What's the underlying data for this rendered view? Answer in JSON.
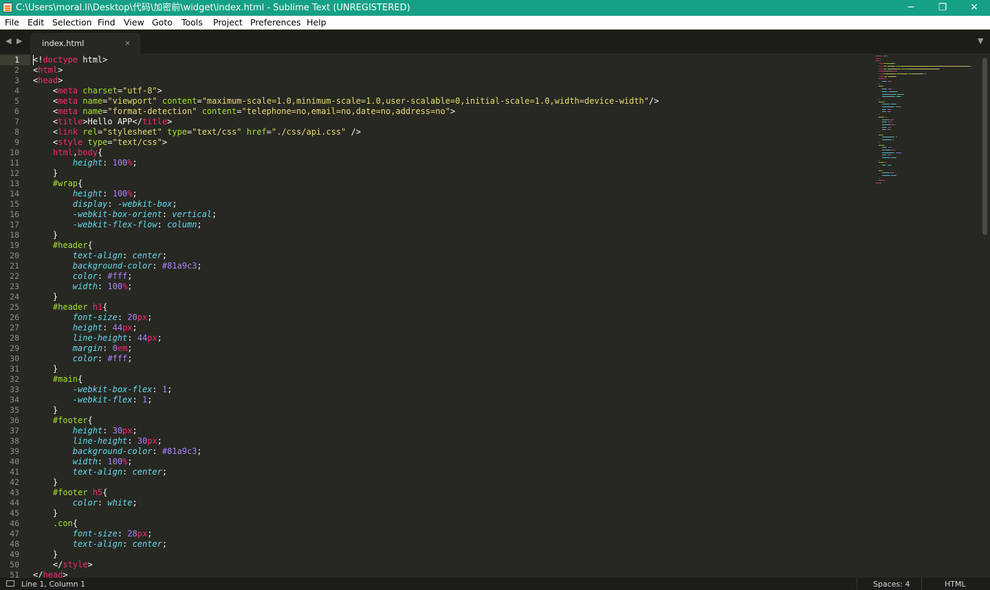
{
  "window": {
    "title": "C:\\Users\\moral.li\\Desktop\\代码\\加密前\\widget\\index.html - Sublime Text (UNREGISTERED)",
    "minimize": "─",
    "restore": "❐",
    "close": "✕",
    "icon": "sublime-text-icon"
  },
  "menu": [
    "File",
    "Edit",
    "Selection",
    "Find",
    "View",
    "Goto",
    "Tools",
    "Project",
    "Preferences",
    "Help"
  ],
  "tabs": [
    {
      "label": "index.html",
      "close": "×",
      "active": true
    }
  ],
  "tab_nav": {
    "left": "◀",
    "right": "▶",
    "dropdown": "▼"
  },
  "editor": {
    "active_line": 1,
    "lines": [
      [
        [
          "t-pun",
          "<!"
        ],
        [
          "t-tag",
          "doctype"
        ],
        [
          "t-pun",
          " html>"
        ]
      ],
      [
        [
          "t-pun",
          "<"
        ],
        [
          "t-tag",
          "html"
        ],
        [
          "t-pun",
          ">"
        ]
      ],
      [
        [
          "t-pun",
          "<"
        ],
        [
          "t-tag",
          "head"
        ],
        [
          "t-pun",
          ">"
        ]
      ],
      [
        [
          "t-pun",
          "    <"
        ],
        [
          "t-tag",
          "meta"
        ],
        [
          "t-pun",
          " "
        ],
        [
          "t-attr",
          "charset"
        ],
        [
          "t-pun",
          "="
        ],
        [
          "t-str",
          "\"utf-8\""
        ],
        [
          "t-pun",
          ">"
        ]
      ],
      [
        [
          "t-pun",
          "    <"
        ],
        [
          "t-tag",
          "meta"
        ],
        [
          "t-pun",
          " "
        ],
        [
          "t-attr",
          "name"
        ],
        [
          "t-pun",
          "="
        ],
        [
          "t-str",
          "\"viewport\""
        ],
        [
          "t-pun",
          " "
        ],
        [
          "t-attr",
          "content"
        ],
        [
          "t-pun",
          "="
        ],
        [
          "t-str",
          "\"maximum-scale=1.0,minimum-scale=1.0,user-scalable=0,initial-scale=1.0,width=device-width\""
        ],
        [
          "t-pun",
          "/>"
        ]
      ],
      [
        [
          "t-pun",
          "    <"
        ],
        [
          "t-tag",
          "meta"
        ],
        [
          "t-pun",
          " "
        ],
        [
          "t-attr",
          "name"
        ],
        [
          "t-pun",
          "="
        ],
        [
          "t-str",
          "\"format-detection\""
        ],
        [
          "t-pun",
          " "
        ],
        [
          "t-attr",
          "content"
        ],
        [
          "t-pun",
          "="
        ],
        [
          "t-str",
          "\"telephone=no,email=no,date=no,address=no\""
        ],
        [
          "t-pun",
          ">"
        ]
      ],
      [
        [
          "t-pun",
          "    <"
        ],
        [
          "t-tag",
          "title"
        ],
        [
          "t-pun",
          ">Hello APP</"
        ],
        [
          "t-tag",
          "title"
        ],
        [
          "t-pun",
          ">"
        ]
      ],
      [
        [
          "t-pun",
          "    <"
        ],
        [
          "t-tag",
          "link"
        ],
        [
          "t-pun",
          " "
        ],
        [
          "t-attr",
          "rel"
        ],
        [
          "t-pun",
          "="
        ],
        [
          "t-str",
          "\"stylesheet\""
        ],
        [
          "t-pun",
          " "
        ],
        [
          "t-attr",
          "type"
        ],
        [
          "t-pun",
          "="
        ],
        [
          "t-str",
          "\"text/css\""
        ],
        [
          "t-pun",
          " "
        ],
        [
          "t-attr",
          "href"
        ],
        [
          "t-pun",
          "="
        ],
        [
          "t-str",
          "\"./css/api.css\""
        ],
        [
          "t-pun",
          " />"
        ]
      ],
      [
        [
          "t-pun",
          "    <"
        ],
        [
          "t-tag",
          "style"
        ],
        [
          "t-pun",
          " "
        ],
        [
          "t-attr",
          "type"
        ],
        [
          "t-pun",
          "="
        ],
        [
          "t-str",
          "\"text/css\""
        ],
        [
          "t-pun",
          ">"
        ]
      ],
      [
        [
          "t-pun",
          "    "
        ],
        [
          "t-tag",
          "html"
        ],
        [
          "t-pun",
          ","
        ],
        [
          "t-tag",
          "body"
        ],
        [
          "t-pun",
          "{"
        ]
      ],
      [
        [
          "t-pun",
          "        "
        ],
        [
          "t-prop",
          "height"
        ],
        [
          "t-pun",
          ": "
        ],
        [
          "t-num",
          "100"
        ],
        [
          "t-unit",
          "%"
        ],
        [
          "t-pun",
          ";"
        ]
      ],
      [
        [
          "t-pun",
          "    }"
        ]
      ],
      [
        [
          "t-pun",
          "    "
        ],
        [
          "t-sel",
          "#wrap"
        ],
        [
          "t-pun",
          "{"
        ]
      ],
      [
        [
          "t-pun",
          "        "
        ],
        [
          "t-prop",
          "height"
        ],
        [
          "t-pun",
          ": "
        ],
        [
          "t-num",
          "100"
        ],
        [
          "t-unit",
          "%"
        ],
        [
          "t-pun",
          ";"
        ]
      ],
      [
        [
          "t-pun",
          "        "
        ],
        [
          "t-prop",
          "display"
        ],
        [
          "t-pun",
          ": "
        ],
        [
          "t-prop",
          "-webkit-box"
        ],
        [
          "t-pun",
          ";"
        ]
      ],
      [
        [
          "t-pun",
          "        "
        ],
        [
          "t-prop",
          "-webkit-box-orient"
        ],
        [
          "t-pun",
          ": "
        ],
        [
          "t-prop",
          "vertical"
        ],
        [
          "t-pun",
          ";"
        ]
      ],
      [
        [
          "t-pun",
          "        "
        ],
        [
          "t-prop",
          "-webkit-flex-flow"
        ],
        [
          "t-pun",
          ": "
        ],
        [
          "t-prop",
          "column"
        ],
        [
          "t-pun",
          ";"
        ]
      ],
      [
        [
          "t-pun",
          "    }"
        ]
      ],
      [
        [
          "t-pun",
          "    "
        ],
        [
          "t-sel",
          "#header"
        ],
        [
          "t-pun",
          "{"
        ]
      ],
      [
        [
          "t-pun",
          "        "
        ],
        [
          "t-prop",
          "text-align"
        ],
        [
          "t-pun",
          ": "
        ],
        [
          "t-prop",
          "center"
        ],
        [
          "t-pun",
          ";"
        ]
      ],
      [
        [
          "t-pun",
          "        "
        ],
        [
          "t-prop",
          "background-color"
        ],
        [
          "t-pun",
          ": "
        ],
        [
          "t-num",
          "#81a9c3"
        ],
        [
          "t-pun",
          ";"
        ]
      ],
      [
        [
          "t-pun",
          "        "
        ],
        [
          "t-prop",
          "color"
        ],
        [
          "t-pun",
          ": "
        ],
        [
          "t-num",
          "#fff"
        ],
        [
          "t-pun",
          ";"
        ]
      ],
      [
        [
          "t-pun",
          "        "
        ],
        [
          "t-prop",
          "width"
        ],
        [
          "t-pun",
          ": "
        ],
        [
          "t-num",
          "100"
        ],
        [
          "t-unit",
          "%"
        ],
        [
          "t-pun",
          ";"
        ]
      ],
      [
        [
          "t-pun",
          "    }"
        ]
      ],
      [
        [
          "t-pun",
          "    "
        ],
        [
          "t-sel",
          "#header "
        ],
        [
          "t-tag",
          "h1"
        ],
        [
          "t-pun",
          "{"
        ]
      ],
      [
        [
          "t-pun",
          "        "
        ],
        [
          "t-prop",
          "font-size"
        ],
        [
          "t-pun",
          ": "
        ],
        [
          "t-num",
          "20"
        ],
        [
          "t-unit",
          "px"
        ],
        [
          "t-pun",
          ";"
        ]
      ],
      [
        [
          "t-pun",
          "        "
        ],
        [
          "t-prop",
          "height"
        ],
        [
          "t-pun",
          ": "
        ],
        [
          "t-num",
          "44"
        ],
        [
          "t-unit",
          "px"
        ],
        [
          "t-pun",
          ";"
        ]
      ],
      [
        [
          "t-pun",
          "        "
        ],
        [
          "t-prop",
          "line-height"
        ],
        [
          "t-pun",
          ": "
        ],
        [
          "t-num",
          "44"
        ],
        [
          "t-unit",
          "px"
        ],
        [
          "t-pun",
          ";"
        ]
      ],
      [
        [
          "t-pun",
          "        "
        ],
        [
          "t-prop",
          "margin"
        ],
        [
          "t-pun",
          ": "
        ],
        [
          "t-num",
          "0"
        ],
        [
          "t-unit",
          "em"
        ],
        [
          "t-pun",
          ";"
        ]
      ],
      [
        [
          "t-pun",
          "        "
        ],
        [
          "t-prop",
          "color"
        ],
        [
          "t-pun",
          ": "
        ],
        [
          "t-num",
          "#fff"
        ],
        [
          "t-pun",
          ";"
        ]
      ],
      [
        [
          "t-pun",
          "    }"
        ]
      ],
      [
        [
          "t-pun",
          "    "
        ],
        [
          "t-sel",
          "#main"
        ],
        [
          "t-pun",
          "{"
        ]
      ],
      [
        [
          "t-pun",
          "        "
        ],
        [
          "t-prop",
          "-webkit-box-flex"
        ],
        [
          "t-pun",
          ": "
        ],
        [
          "t-num",
          "1"
        ],
        [
          "t-pun",
          ";"
        ]
      ],
      [
        [
          "t-pun",
          "        "
        ],
        [
          "t-prop",
          "-webkit-flex"
        ],
        [
          "t-pun",
          ": "
        ],
        [
          "t-num",
          "1"
        ],
        [
          "t-pun",
          ";"
        ]
      ],
      [
        [
          "t-pun",
          "    }"
        ]
      ],
      [
        [
          "t-pun",
          "    "
        ],
        [
          "t-sel",
          "#footer"
        ],
        [
          "t-pun",
          "{"
        ]
      ],
      [
        [
          "t-pun",
          "        "
        ],
        [
          "t-prop",
          "height"
        ],
        [
          "t-pun",
          ": "
        ],
        [
          "t-num",
          "30"
        ],
        [
          "t-unit",
          "px"
        ],
        [
          "t-pun",
          ";"
        ]
      ],
      [
        [
          "t-pun",
          "        "
        ],
        [
          "t-prop",
          "line-height"
        ],
        [
          "t-pun",
          ": "
        ],
        [
          "t-num",
          "30"
        ],
        [
          "t-unit",
          "px"
        ],
        [
          "t-pun",
          ";"
        ]
      ],
      [
        [
          "t-pun",
          "        "
        ],
        [
          "t-prop",
          "background-color"
        ],
        [
          "t-pun",
          ": "
        ],
        [
          "t-num",
          "#81a9c3"
        ],
        [
          "t-pun",
          ";"
        ]
      ],
      [
        [
          "t-pun",
          "        "
        ],
        [
          "t-prop",
          "width"
        ],
        [
          "t-pun",
          ": "
        ],
        [
          "t-num",
          "100"
        ],
        [
          "t-unit",
          "%"
        ],
        [
          "t-pun",
          ";"
        ]
      ],
      [
        [
          "t-pun",
          "        "
        ],
        [
          "t-prop",
          "text-align"
        ],
        [
          "t-pun",
          ": "
        ],
        [
          "t-prop",
          "center"
        ],
        [
          "t-pun",
          ";"
        ]
      ],
      [
        [
          "t-pun",
          "    }"
        ]
      ],
      [
        [
          "t-pun",
          "    "
        ],
        [
          "t-sel",
          "#footer "
        ],
        [
          "t-tag",
          "h5"
        ],
        [
          "t-pun",
          "{"
        ]
      ],
      [
        [
          "t-pun",
          "        "
        ],
        [
          "t-prop",
          "color"
        ],
        [
          "t-pun",
          ": "
        ],
        [
          "t-prop",
          "white"
        ],
        [
          "t-pun",
          ";"
        ]
      ],
      [
        [
          "t-pun",
          "    }"
        ]
      ],
      [
        [
          "t-pun",
          "    "
        ],
        [
          "t-sel",
          ".con"
        ],
        [
          "t-pun",
          "{"
        ]
      ],
      [
        [
          "t-pun",
          "        "
        ],
        [
          "t-prop",
          "font-size"
        ],
        [
          "t-pun",
          ": "
        ],
        [
          "t-num",
          "28"
        ],
        [
          "t-unit",
          "px"
        ],
        [
          "t-pun",
          ";"
        ]
      ],
      [
        [
          "t-pun",
          "        "
        ],
        [
          "t-prop",
          "text-align"
        ],
        [
          "t-pun",
          ": "
        ],
        [
          "t-prop",
          "center"
        ],
        [
          "t-pun",
          ";"
        ]
      ],
      [
        [
          "t-pun",
          "    }"
        ]
      ],
      [
        [
          "t-pun",
          "    </"
        ],
        [
          "t-tag",
          "style"
        ],
        [
          "t-pun",
          ">"
        ]
      ],
      [
        [
          "t-pun",
          "</"
        ],
        [
          "t-tag",
          "head"
        ],
        [
          "t-pun",
          ">"
        ]
      ]
    ]
  },
  "status": {
    "position": "Line 1, Column 1",
    "spaces": "Spaces: 4",
    "syntax": "HTML",
    "icon": "panel-toggle-icon"
  },
  "colors": {
    "titlebar": "#16a086",
    "editor_bg": "#272822",
    "tag": "#f92672",
    "attr": "#a6e22e",
    "string": "#e6db74",
    "property": "#66d9ef",
    "number": "#ae81ff"
  }
}
